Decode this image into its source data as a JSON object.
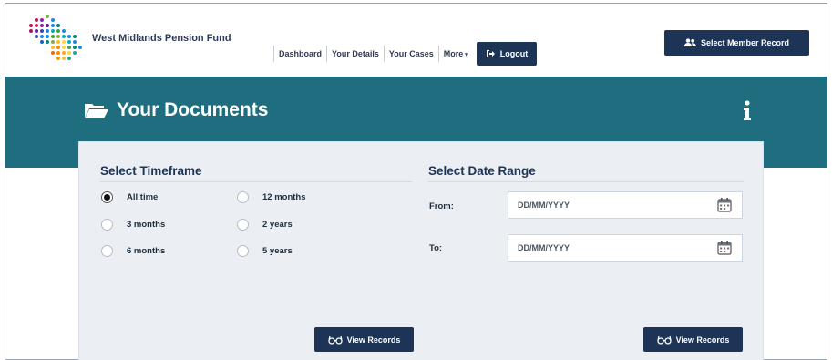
{
  "header": {
    "brand": "West Midlands Pension Fund",
    "nav": [
      {
        "label": "Dashboard"
      },
      {
        "label": "Your Details"
      },
      {
        "label": "Your Cases"
      },
      {
        "label": "More"
      }
    ],
    "logout_label": "Logout",
    "select_member_label": "Select Member Record"
  },
  "page": {
    "title": "Your Documents"
  },
  "timeframe": {
    "title": "Select Timeframe",
    "options": [
      {
        "label": "All time",
        "selected": true
      },
      {
        "label": "3 months",
        "selected": false
      },
      {
        "label": "6 months",
        "selected": false
      },
      {
        "label": "12 months",
        "selected": false
      },
      {
        "label": "2 years",
        "selected": false
      },
      {
        "label": "5 years",
        "selected": false
      }
    ],
    "button_label": "View Records"
  },
  "date_range": {
    "title": "Select Date Range",
    "from_label": "From:",
    "from_placeholder": "DD/MM/YYYY",
    "to_label": "To:",
    "to_placeholder": "DD/MM/YYYY",
    "button_label": "View Records"
  },
  "colors": {
    "brand_navy": "#1d3456",
    "band_teal": "#1e6e7f",
    "panel_bg": "#ebeff4"
  },
  "icons": [
    "logo-dots",
    "logout-icon",
    "users-icon",
    "folder-open-icon",
    "info-icon",
    "calendar-icon",
    "glasses-icon"
  ]
}
